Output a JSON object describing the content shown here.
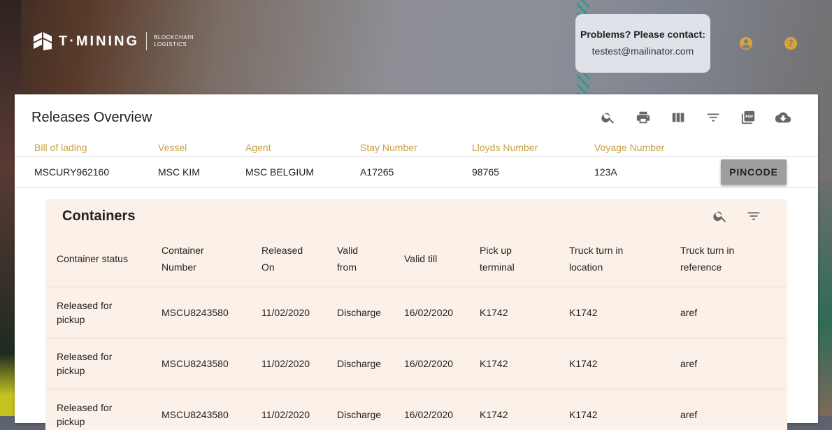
{
  "brand": {
    "name": "T·MINING",
    "sub_line1": "BLOCKCHAIN",
    "sub_line2": "LOGISTICS"
  },
  "contact": {
    "heading": "Problems? Please contact:",
    "email": "testest@mailinator.com"
  },
  "header_icons": [
    "account-circle-icon",
    "help-circle-icon"
  ],
  "colors": {
    "accent": "#c9a24a",
    "icon_orange": "#d9a13a",
    "panel_bg": "#fcf1e8",
    "pincode_bg": "#9e9e9e"
  },
  "release": {
    "title": "Releases Overview",
    "toolbar_icons": [
      "search-icon",
      "print-icon",
      "view-column-icon",
      "filter-icon",
      "pdf-icon",
      "cloud-download-icon"
    ],
    "columns": [
      "Bill of lading",
      "Vessel",
      "Agent",
      "Stay Number",
      "Lloyds Number",
      "Voyage Number"
    ],
    "row": [
      "MSCURY962160",
      "MSC KIM",
      "MSC BELGIUM",
      "A17265",
      "98765",
      "123A"
    ],
    "pincode_label": "PINCODE"
  },
  "containers": {
    "title": "Containers",
    "toolbar_icons": [
      "search-icon",
      "filter-icon"
    ],
    "columns": [
      [
        "Container status",
        ""
      ],
      [
        "Container",
        "Number"
      ],
      [
        "Released",
        "On"
      ],
      [
        "Valid",
        "from"
      ],
      [
        "Valid till",
        ""
      ],
      [
        "Pick up",
        "terminal"
      ],
      [
        "Truck turn in",
        "location"
      ],
      [
        "Truck turn in",
        "reference"
      ]
    ],
    "rows": [
      {
        "status": [
          "Released for",
          "pickup"
        ],
        "number": "MSCU8243580",
        "released": "11/02/2020",
        "valid_from": "Discharge",
        "valid_till": "16/02/2020",
        "terminal": "K1742",
        "tti_location": "K1742",
        "tti_reference": "aref"
      },
      {
        "status": [
          "Released for",
          "pickup"
        ],
        "number": "MSCU8243580",
        "released": "11/02/2020",
        "valid_from": "Discharge",
        "valid_till": "16/02/2020",
        "terminal": "K1742",
        "tti_location": "K1742",
        "tti_reference": "aref"
      },
      {
        "status": [
          "Released for",
          "pickup"
        ],
        "number": "MSCU8243580",
        "released": "11/02/2020",
        "valid_from": "Discharge",
        "valid_till": "16/02/2020",
        "terminal": "K1742",
        "tti_location": "K1742",
        "tti_reference": "aref"
      }
    ]
  }
}
